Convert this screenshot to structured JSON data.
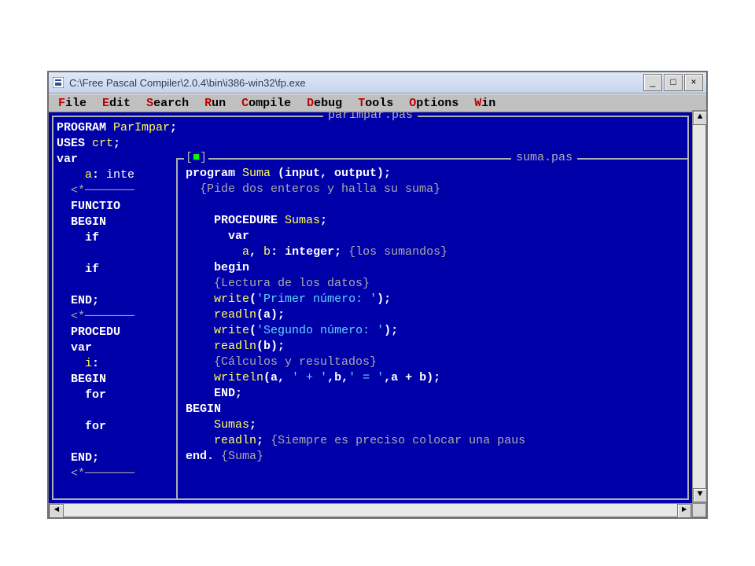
{
  "window": {
    "title": "C:\\Free Pascal Compiler\\2.0.4\\bin\\i386-win32\\fp.exe",
    "btn_min": "_",
    "btn_max": "□",
    "btn_close": "×"
  },
  "menu": [
    {
      "hot": "F",
      "rest": "ile"
    },
    {
      "hot": "E",
      "rest": "dit"
    },
    {
      "hot": "S",
      "rest": "earch"
    },
    {
      "hot": "R",
      "rest": "un"
    },
    {
      "hot": "C",
      "rest": "ompile"
    },
    {
      "hot": "D",
      "rest": "ebug"
    },
    {
      "hot": "T",
      "rest": "ools"
    },
    {
      "hot": "O",
      "rest": "ptions"
    },
    {
      "hot": "W",
      "rest": "in"
    }
  ],
  "scroll": {
    "left": "◄",
    "right": "►",
    "up": "▲",
    "down": "▼"
  },
  "editor": {
    "bg_title": "parimpar.pas",
    "fg_title": "suma.pas",
    "fg_close_l": "[",
    "fg_close_r": "]",
    "fg_close_sq": "■",
    "bg_code_html": "<span class=\"kw\">PROGRAM </span><span class=\"id\">ParImpar</span><span class=\"kw\">;</span>\n<span class=\"kw\">USES </span><span class=\"id\">crt</span><span class=\"kw\">;</span>\n<span class=\"kw\">var</span>\n    <span class=\"id\">a</span><span class=\"kw\">: </span><span class=\"ty\">inte</span>\n  <span class=\"gr\">&lt;</span><span class=\"gr\">*───────</span>\n  <span class=\"kw\">FUNCTIO</span>\n  <span class=\"kw\">BEGIN</span>\n    <span class=\"kw\">if</span>\n\n    <span class=\"kw\">if</span>\n\n  <span class=\"kw\">END;</span>\n  <span class=\"gr\">&lt;</span><span class=\"gr\">*───────</span>\n  <span class=\"kw\">PROCEDU</span>\n  <span class=\"kw\">var</span>\n    <span class=\"id\">i</span><span class=\"kw\">:</span>\n  <span class=\"kw\">BEGIN</span>\n    <span class=\"kw\">for</span>\n\n    <span class=\"kw\">for</span>\n\n  <span class=\"kw\">END;</span>\n  <span class=\"gr\">&lt;</span><span class=\"gr\">*───────</span>",
    "fg_code_html": "<span class=\"kw\">program </span><span class=\"id\">Suma </span><span class=\"kw\">(input, output);</span>\n  <span class=\"cm\">{Pide dos enteros y halla su suma}</span>\n\n    <span class=\"kw\">PROCEDURE </span><span class=\"id\">Sumas</span><span class=\"kw\">;</span>\n      <span class=\"kw\">var</span>\n        <span class=\"id\">a</span><span class=\"kw\">, </span><span class=\"id\">b</span><span class=\"kw\">: integer;</span> <span class=\"cm\">{los sumandos}</span>\n    <span class=\"kw\">begin</span>\n    <span class=\"cm\">{Lectura de los datos}</span>\n    <span class=\"id\">write</span><span class=\"kw\">(</span><span class=\"str\">'Primer número: '</span><span class=\"kw\">);</span>\n    <span class=\"id\">readln</span><span class=\"kw\">(a);</span>\n    <span class=\"id\">write</span><span class=\"kw\">(</span><span class=\"str\">'Segundo número: '</span><span class=\"kw\">);</span>\n    <span class=\"id\">readln</span><span class=\"kw\">(b);</span>\n    <span class=\"cm\">{Cálculos y resultados}</span>\n    <span class=\"id\">writeln</span><span class=\"kw\">(a, </span><span class=\"str\">' + '</span><span class=\"kw\">,b,</span><span class=\"str\">' = '</span><span class=\"kw\">,a + b);</span>\n    <span class=\"kw\">END;</span>\n<span class=\"kw\">BEGIN</span>\n    <span class=\"id\">Sumas</span><span class=\"kw\">;</span>\n    <span class=\"id\">readln</span><span class=\"kw\">;</span> <span class=\"cm\">{Siempre es preciso colocar una paus</span>\n<span class=\"kw\">end.</span> <span class=\"cm\">{Suma}</span>"
  }
}
